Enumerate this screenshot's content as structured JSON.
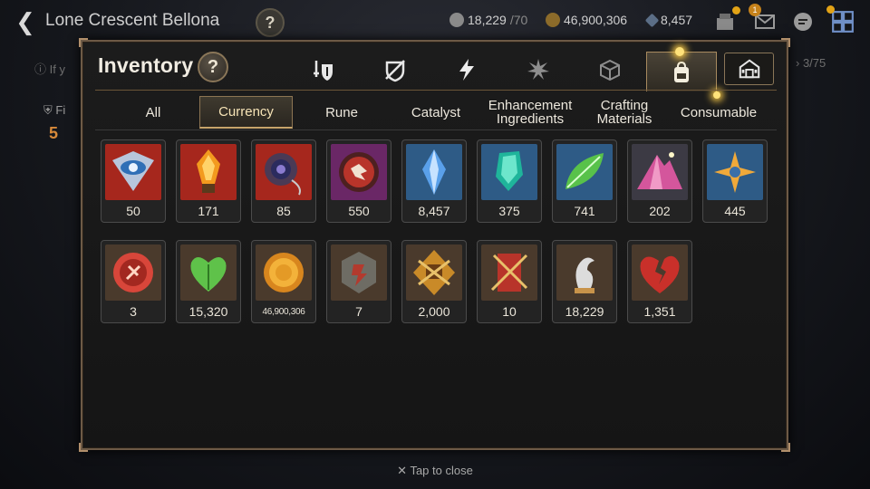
{
  "topbar": {
    "title": "Lone Crescent Bellona",
    "help": "?",
    "stamina": "18,229",
    "stamina_max": "/70",
    "gold": "46,900,306",
    "skystone": "8,457",
    "mail_badge": "1"
  },
  "behind": {
    "hint": "If y",
    "count": "3/75",
    "fi": "Fi",
    "five": "5"
  },
  "modal": {
    "title": "Inventory",
    "help": "?",
    "filter_tabs": [
      {
        "icon": "equipment-icon"
      },
      {
        "icon": "artifact-icon"
      },
      {
        "icon": "lightning-icon"
      },
      {
        "icon": "material-burst-icon"
      },
      {
        "icon": "box-icon"
      },
      {
        "icon": "backpack-icon",
        "active": true
      }
    ],
    "storage_icon": "storage-icon",
    "categories": [
      {
        "label": "All"
      },
      {
        "label": "Currency",
        "active": true
      },
      {
        "label": "Rune"
      },
      {
        "label": "Catalyst"
      },
      {
        "label": "Enhancement Ingredients"
      },
      {
        "label": "Crafting Materials"
      },
      {
        "label": "Consumable"
      }
    ],
    "items": [
      {
        "icon": "eye-crest-icon",
        "qty": "50",
        "bg": "#a6271d"
      },
      {
        "icon": "flame-crystal-icon",
        "qty": "171",
        "bg": "#a6271d"
      },
      {
        "icon": "portal-amulet-icon",
        "qty": "85",
        "bg": "#a6271d"
      },
      {
        "icon": "seal-orb-icon",
        "qty": "550",
        "bg": "#6a2766"
      },
      {
        "icon": "skystone-icon",
        "qty": "8,457",
        "bg": "#2e5b86"
      },
      {
        "icon": "teal-crystal-icon",
        "qty": "375",
        "bg": "#2e5b86"
      },
      {
        "icon": "leaf-icon",
        "qty": "741",
        "bg": "#2e5b86"
      },
      {
        "icon": "pink-peak-icon",
        "qty": "202",
        "bg": "#3c3a44"
      },
      {
        "icon": "star-compass-icon",
        "qty": "445",
        "bg": "#2e5b86"
      },
      {
        "icon": "red-medal-icon",
        "qty": "3",
        "bg": "#4a3a2c"
      },
      {
        "icon": "heart-leaf-icon",
        "qty": "15,320",
        "bg": "#4a3a2c"
      },
      {
        "icon": "gold-coin-icon",
        "qty": "46,900,306",
        "bg": "#4a3a2c",
        "small": true
      },
      {
        "icon": "stone-tablet-icon",
        "qty": "7",
        "bg": "#4a3a2c"
      },
      {
        "icon": "fist-badge-icon",
        "qty": "2,000",
        "bg": "#4a3a2c"
      },
      {
        "icon": "sword-banner-icon",
        "qty": "10",
        "bg": "#4a3a2c"
      },
      {
        "icon": "stamina-horse-icon",
        "qty": "18,229",
        "bg": "#4a3a2c"
      },
      {
        "icon": "broken-heart-icon",
        "qty": "1,351",
        "bg": "#4a3a2c"
      }
    ],
    "tap_close": "Tap to close"
  }
}
